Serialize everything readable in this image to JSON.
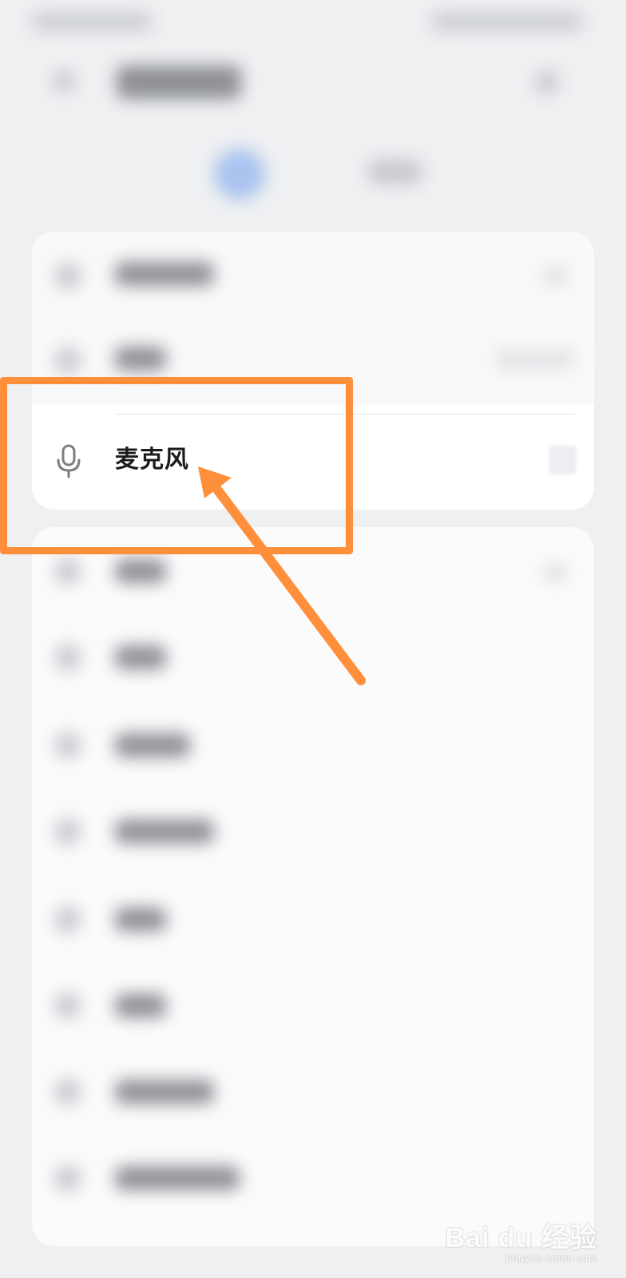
{
  "settings_list": {
    "highlighted_item": {
      "label": "麦克风",
      "icon": "microphone-icon"
    }
  },
  "annotation": {
    "box_color": "#ff8f3a",
    "arrow_color": "#ff8f3a"
  },
  "watermark": {
    "logo": "Bai du 经验",
    "url": "jingyan.baidu.com"
  }
}
